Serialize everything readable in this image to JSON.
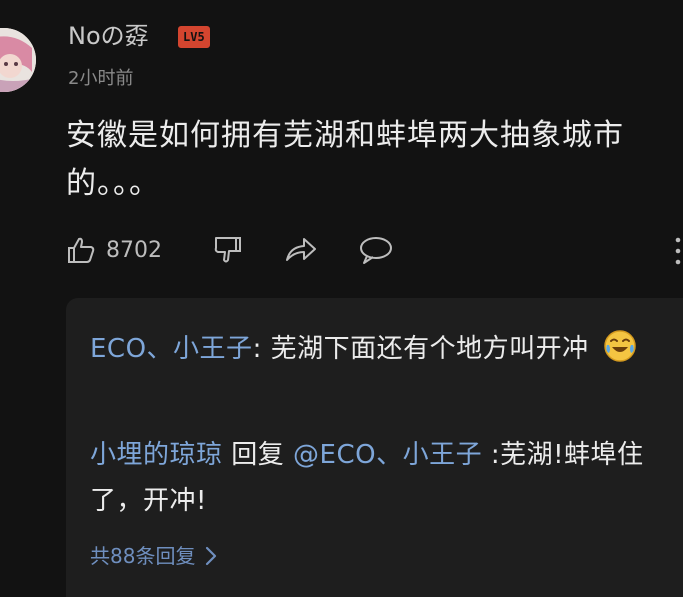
{
  "comment": {
    "username": "Noの孬",
    "level_badge": "LV5",
    "timestamp": "2小时前",
    "text": "安徽是如何拥有芜湖和蚌埠两大抽象城市的。。。",
    "like_count": "8702"
  },
  "replies": {
    "reply1": {
      "author": "ECO、小王子",
      "colon": ": ",
      "text": "芜湖下面还有个地方叫开冲"
    },
    "reply2": {
      "author": "小埋的琼琼",
      "reply_word": " 回复 ",
      "target": "@ECO、小王子",
      "text": " :芜湖!蚌埠住了，开冲!"
    },
    "see_more": "共88条回复"
  },
  "colors": {
    "background": "#121212",
    "reply_panel": "#1e1e1e",
    "mention": "#7ea6d9",
    "level_badge": "#d3452f"
  },
  "icons": [
    "thumb-up-icon",
    "thumb-down-icon",
    "share-icon",
    "comment-icon",
    "more-vertical-icon",
    "laughing-crying-emoji",
    "chevron-right-icon"
  ]
}
